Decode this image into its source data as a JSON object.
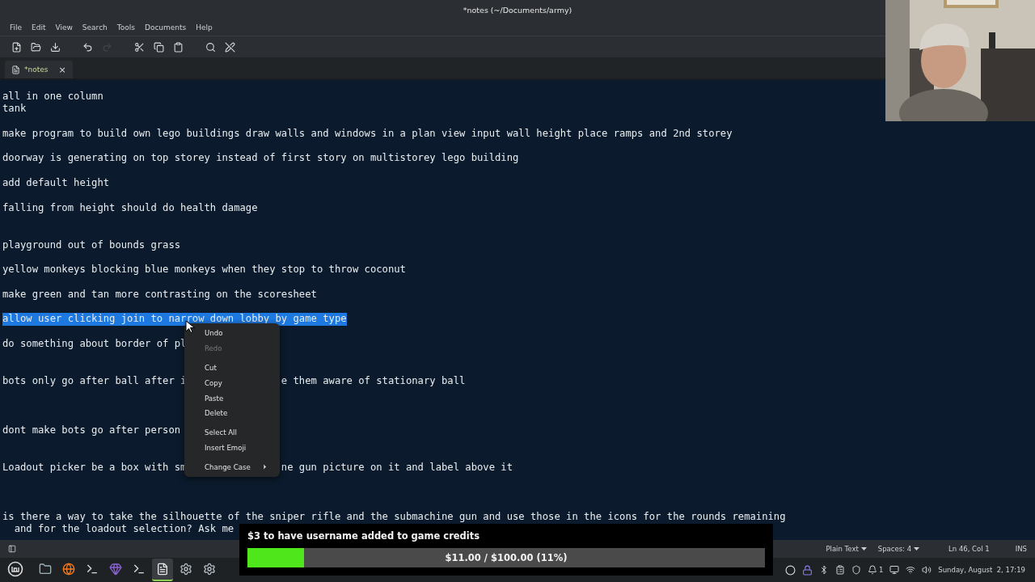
{
  "window": {
    "title": "*notes (~/Documents/army)"
  },
  "menubar": [
    "File",
    "Edit",
    "View",
    "Search",
    "Tools",
    "Documents",
    "Help"
  ],
  "toolbar": [
    {
      "disabled": false
    },
    {
      "disabled": false
    },
    {
      "disabled": false
    },
    {
      "disabled": false
    },
    {
      "disabled": true
    },
    {
      "disabled": false
    },
    {
      "disabled": false
    },
    {
      "disabled": false
    },
    {
      "disabled": false
    },
    {
      "disabled": false
    }
  ],
  "tabs": [
    {
      "label": "*notes",
      "selected": true,
      "close": "×"
    }
  ],
  "editor": {
    "lines": [
      {
        "kind": "text",
        "text": "all in one column"
      },
      {
        "kind": "text",
        "text": "tank"
      },
      {
        "kind": "blank"
      },
      {
        "kind": "text",
        "text": "make program to build own lego buildings draw walls and windows in a plan view input wall height place ramps and 2nd storey"
      },
      {
        "kind": "blank"
      },
      {
        "kind": "text",
        "text": "doorway is generating on top storey instead of first story on multistorey lego building"
      },
      {
        "kind": "blank"
      },
      {
        "kind": "text",
        "text": "add default height"
      },
      {
        "kind": "blank"
      },
      {
        "kind": "text",
        "text": "falling from height should do health damage"
      },
      {
        "kind": "blank"
      },
      {
        "kind": "blank"
      },
      {
        "kind": "text",
        "text": "playground out of bounds grass"
      },
      {
        "kind": "blank"
      },
      {
        "kind": "text",
        "text": "yellow monkeys blocking blue monkeys when they stop to throw coconut"
      },
      {
        "kind": "blank"
      },
      {
        "kind": "text",
        "text": "make green and tan more contrasting on the scoresheet"
      },
      {
        "kind": "blank"
      },
      {
        "kind": "text",
        "text": "allow user clicking join to narrow down lobby by game type",
        "selected": true
      },
      {
        "kind": "blank"
      },
      {
        "kind": "text",
        "text": "do something about border of pl"
      },
      {
        "kind": "blank"
      },
      {
        "kind": "blank"
      },
      {
        "kind": "text",
        "text": "bots only go after ball after i",
        "after": "e them aware of stationary ball"
      },
      {
        "kind": "blank"
      },
      {
        "kind": "blank"
      },
      {
        "kind": "blank"
      },
      {
        "kind": "text",
        "text": "dont make bots go after person"
      },
      {
        "kind": "blank"
      },
      {
        "kind": "blank"
      },
      {
        "kind": "text",
        "text": "Loadout picker be a box with sm",
        "after": "ne gun picture on it and label above it"
      },
      {
        "kind": "blank"
      },
      {
        "kind": "blank"
      },
      {
        "kind": "blank"
      },
      {
        "kind": "text",
        "text": "is there a way to take the silhouette of the sniper rifle and the submachine gun and use those in the icons for the rounds remaining"
      },
      {
        "kind": "wrap",
        "text": "and for the loadout selection? Ask me"
      }
    ]
  },
  "context_menu": [
    [
      {
        "label": "Undo",
        "disabled": false
      },
      {
        "label": "Redo",
        "disabled": true
      }
    ],
    [
      {
        "label": "Cut",
        "disabled": false
      },
      {
        "label": "Copy",
        "disabled": false
      },
      {
        "label": "Paste",
        "disabled": false
      },
      {
        "label": "Delete",
        "disabled": false
      }
    ],
    [
      {
        "label": "Select All",
        "disabled": false
      },
      {
        "label": "Insert Emoji",
        "disabled": false
      }
    ],
    [
      {
        "label": "Change Case",
        "disabled": false,
        "submenu": true
      }
    ]
  ],
  "status_bar": {
    "language": "Plain Text",
    "spaces": "Spaces: 4",
    "position": "Ln 46, Col 1",
    "mode": "INS"
  },
  "taskbar": {
    "apps": [
      {
        "active": false
      },
      {
        "active": false
      },
      {
        "active": false
      },
      {
        "active": false
      },
      {
        "active": false
      },
      {
        "active": true
      },
      {
        "active": false
      },
      {
        "active": false
      }
    ],
    "notification_count": "1",
    "clock": "Sunday, August  2, 17:19"
  },
  "donation": {
    "title": "$3 to have username added to game credits",
    "level": 0.11,
    "reading": "$11.00 / $100.00 (11%)"
  },
  "webcam": {
    "kind": "picture"
  }
}
